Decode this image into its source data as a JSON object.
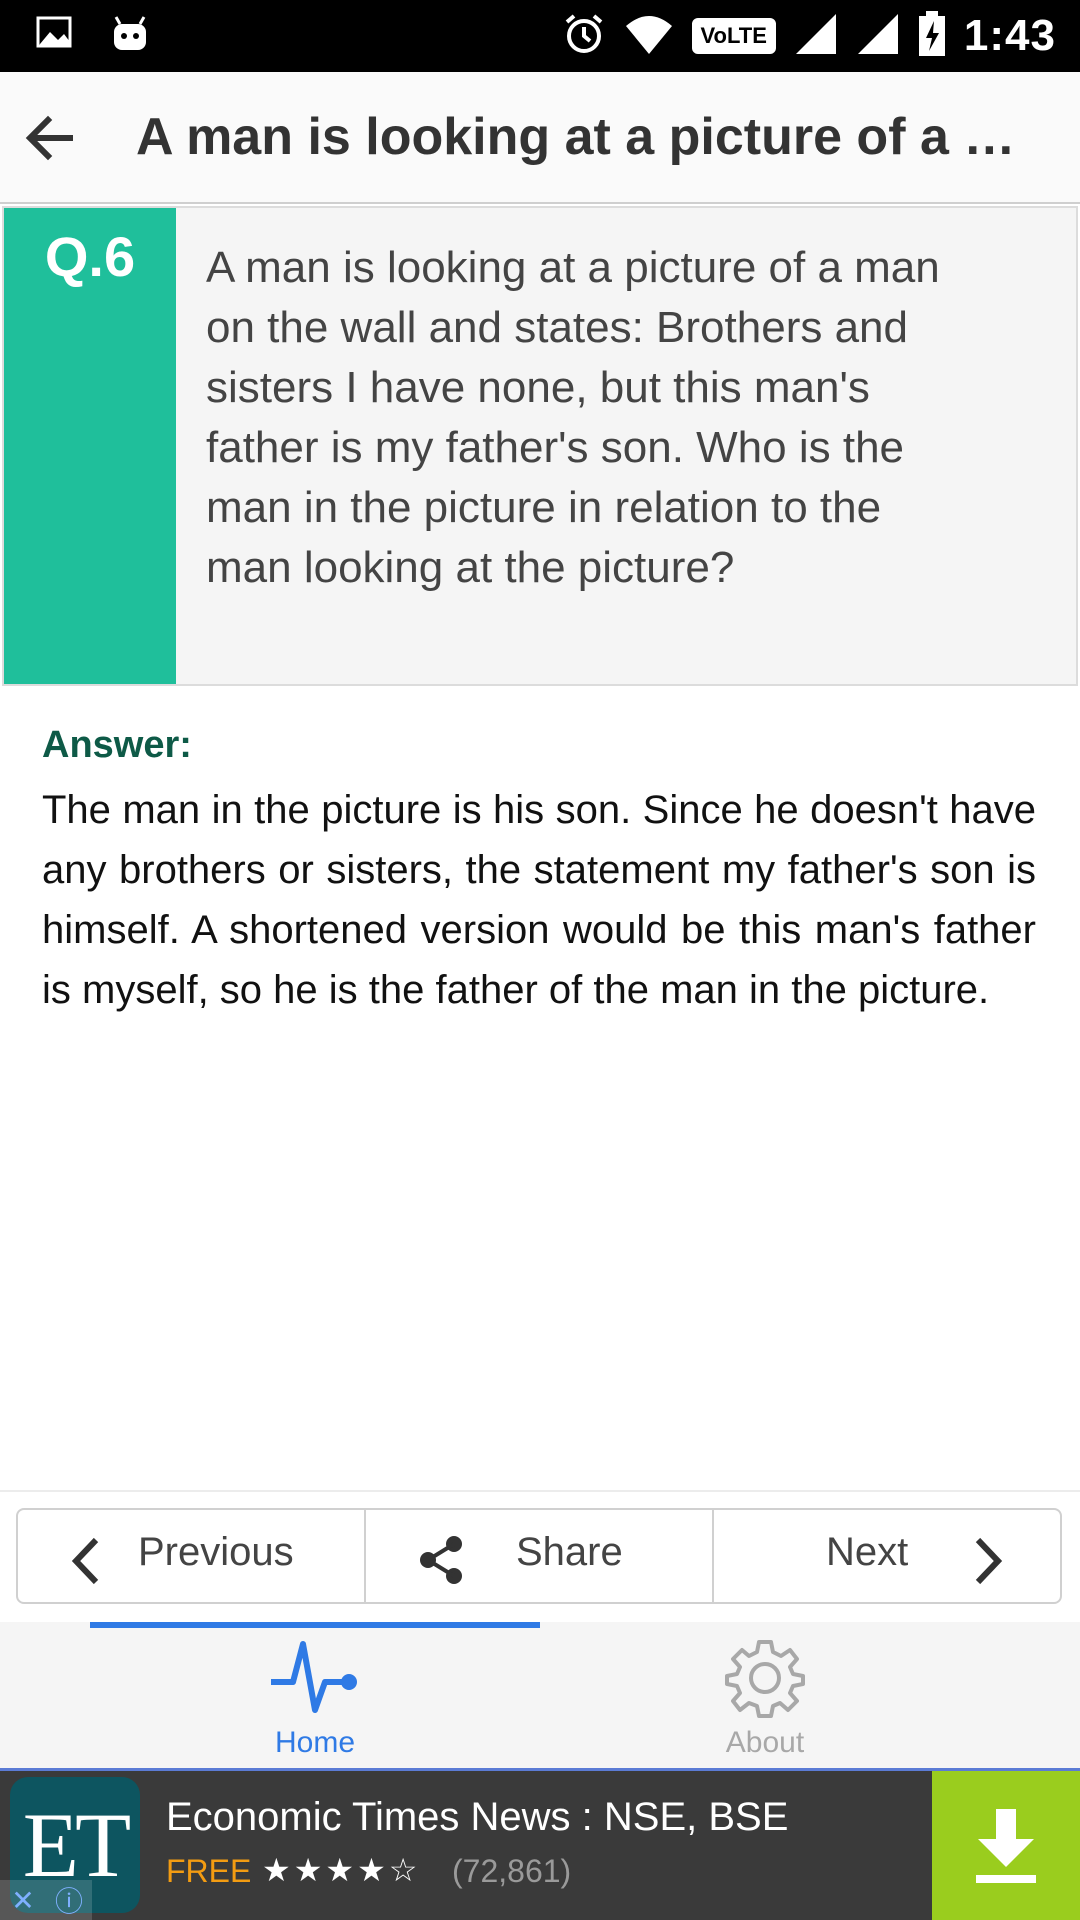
{
  "status_bar": {
    "time": "1:43",
    "volte_label": "VoLTE",
    "icons": [
      "gallery-icon",
      "android-icon",
      "alarm-icon",
      "wifi-icon",
      "signal-icon",
      "signal-icon",
      "battery-charging-icon"
    ]
  },
  "app_bar": {
    "title": "A man is looking at a picture of a man on the wall and states: Brothers and sisters I have none, but this man's father is my father's son. Who is the man in the picture in relation to the man looking at the picture?"
  },
  "question": {
    "number": "Q.6",
    "text": "A man is looking at a picture of a man on the wall and states: Brothers and sisters I have none, but this man's father is my father's son. Who is the man in the picture in relation to the man looking at the picture?"
  },
  "answer": {
    "label": "Answer:",
    "text": "The man in the picture is his son. Since he doesn't have any brothers or sisters, the statement my father's son is himself. A shortened version would be this man's father is myself, so he is the father of the man in the picture."
  },
  "nav": {
    "previous": "Previous",
    "share": "Share",
    "next": "Next"
  },
  "tabs": [
    {
      "label": "Home",
      "icon": "pulse-icon",
      "active": true
    },
    {
      "label": "About",
      "icon": "gear-icon",
      "active": false
    }
  ],
  "ad": {
    "logo": "ET",
    "title": "Economic Times News : NSE, BSE",
    "price": "FREE",
    "stars": "★★★★☆",
    "rating_count": "(72,861)"
  },
  "colors": {
    "accent_green": "#1fbf9b",
    "answer_label": "#0e5a47",
    "tab_active": "#2f7ae5",
    "tab_inactive": "#a8a8a8",
    "ad_download": "#9acd1e"
  }
}
